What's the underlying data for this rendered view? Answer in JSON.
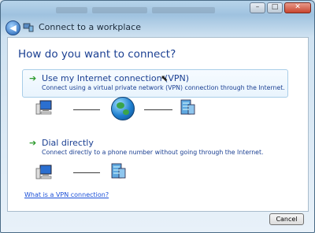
{
  "window": {
    "title": "Connect to a workplace",
    "controls": {
      "minimize": "–",
      "maximize": "□",
      "close": "✕"
    }
  },
  "heading": "How do you want to connect?",
  "options": [
    {
      "title": "Use my Internet connection (VPN)",
      "description": "Connect using a virtual private network (VPN) connection through the Internet."
    },
    {
      "title": "Dial directly",
      "description": "Connect directly to a phone number without going through the Internet."
    }
  ],
  "help_link": "What is a VPN connection?",
  "buttons": {
    "cancel": "Cancel"
  },
  "icons": {
    "back": "back-arrow-icon",
    "page": "workplace-connection-icon",
    "computer": "computer-icon",
    "internet": "globe-icon",
    "server": "workplace-server-icon",
    "option_arrow": "green-arrow-icon"
  },
  "colors": {
    "heading": "#1a3f92",
    "link": "#1a4fd8",
    "arrow": "#2e9b2e",
    "accent": "#a8cde8"
  }
}
